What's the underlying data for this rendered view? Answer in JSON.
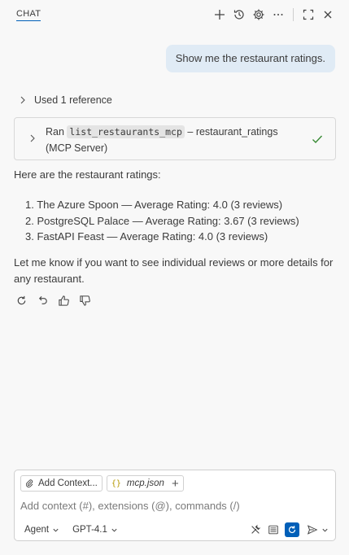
{
  "header": {
    "tab_label": "CHAT",
    "actions": [
      "new-chat",
      "history",
      "settings",
      "more",
      "maximize",
      "close"
    ]
  },
  "user_message": "Show me the restaurant ratings.",
  "references": {
    "label": "Used 1 reference"
  },
  "tool_call": {
    "prefix": "Ran",
    "tool_name": "list_restaurants_mcp",
    "suffix": "– restaurant_ratings",
    "server": "(MCP Server)",
    "status_color": "#388a34"
  },
  "response": {
    "intro": "Here are the restaurant ratings:",
    "items": [
      "1. The Azure Spoon — Average Rating: 4.0 (3 reviews)",
      "2. PostgreSQL Palace — Average Rating: 3.67 (3 reviews)",
      "3. FastAPI Feast — Average Rating: 4.0 (3 reviews)"
    ],
    "outro": "Let me know if you want to see individual reviews or more details for any restaurant."
  },
  "composer": {
    "add_context_label": "Add Context...",
    "file_chip": "mcp.json",
    "placeholder": "Add context (#), extensions (@), commands (/)",
    "mode_label": "Agent",
    "model_label": "GPT-4.1",
    "accent": "#005fb8"
  }
}
